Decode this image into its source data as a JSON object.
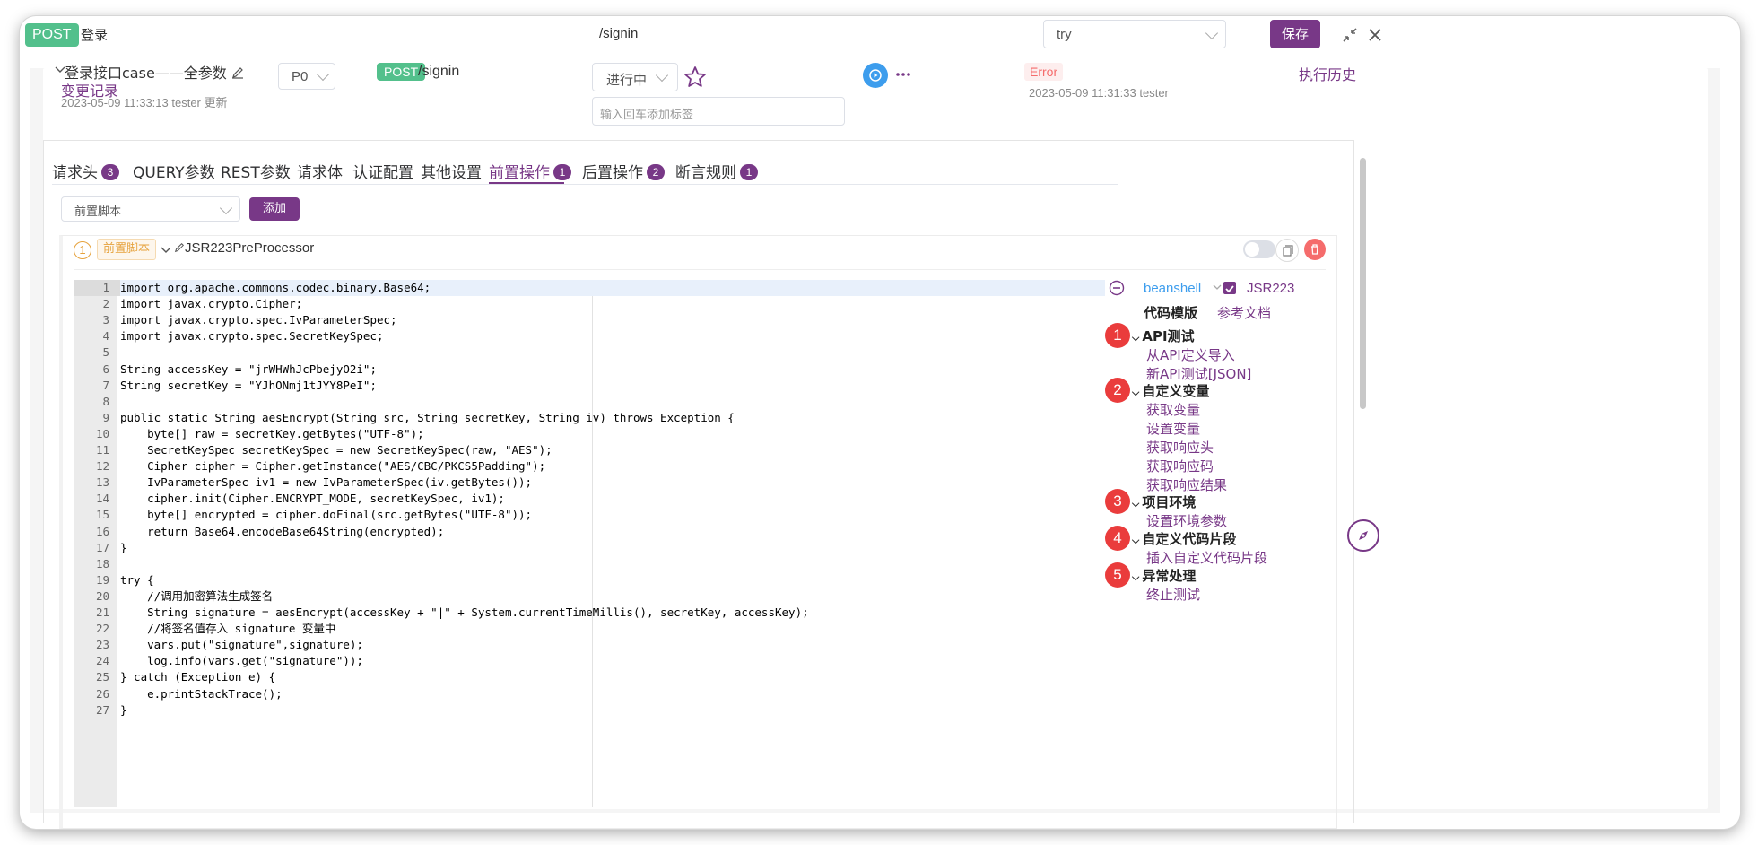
{
  "header": {
    "method": "POST",
    "name": "登录",
    "path": "/signin",
    "env_select": "try",
    "save_label": "保存"
  },
  "case": {
    "title": "登录接口case——全参数",
    "change_log": "变更记录",
    "updated": "2023-05-09 11:33:13 tester 更新",
    "priority": "P0",
    "method": "POST",
    "path": "/signin",
    "status": "进行中",
    "tag_placeholder": "输入回车添加标签",
    "result": "Error",
    "result_time": "2023-05-09 11:31:33 tester",
    "history": "执行历史"
  },
  "tabs": [
    {
      "label": "请求头",
      "count": "3"
    },
    {
      "label": "QUERY参数",
      "count": ""
    },
    {
      "label": "REST参数",
      "count": ""
    },
    {
      "label": "请求体",
      "count": ""
    },
    {
      "label": "认证配置",
      "count": ""
    },
    {
      "label": "其他设置",
      "count": ""
    },
    {
      "label": "前置操作",
      "count": "1"
    },
    {
      "label": "后置操作",
      "count": "2"
    },
    {
      "label": "断言规则",
      "count": "1"
    }
  ],
  "pre": {
    "type_select": "前置脚本",
    "add_label": "添加",
    "step_no": "1",
    "step_tag": "前置脚本",
    "step_name": "JSR223PreProcessor"
  },
  "code_lines": [
    "import org.apache.commons.codec.binary.Base64;",
    "import javax.crypto.Cipher;",
    "import javax.crypto.spec.IvParameterSpec;",
    "import javax.crypto.spec.SecretKeySpec;",
    "",
    "String accessKey = \"jrWHWhJcPbejyO2i\";",
    "String secretKey = \"YJhONmj1tJYY8PeI\";",
    "",
    "public static String aesEncrypt(String src, String secretKey, String iv) throws Exception {",
    "    byte[] raw = secretKey.getBytes(\"UTF-8\");",
    "    SecretKeySpec secretKeySpec = new SecretKeySpec(raw, \"AES\");",
    "    Cipher cipher = Cipher.getInstance(\"AES/CBC/PKCS5Padding\");",
    "    IvParameterSpec iv1 = new IvParameterSpec(iv.getBytes());",
    "    cipher.init(Cipher.ENCRYPT_MODE, secretKeySpec, iv1);",
    "    byte[] encrypted = cipher.doFinal(src.getBytes(\"UTF-8\"));",
    "    return Base64.encodeBase64String(encrypted);",
    "}",
    "",
    "try {",
    "    //调用加密算法生成签名",
    "    String signature = aesEncrypt(accessKey + \"|\" + System.currentTimeMillis(), secretKey, accessKey);",
    "    //将签名值存入 signature 变量中",
    "    vars.put(\"signature\",signature);",
    "    log.info(vars.get(\"signature\"));",
    "} catch (Exception e) {",
    "    e.printStackTrace();",
    "}"
  ],
  "side": {
    "language": "beanshell",
    "jsr_label": "JSR223",
    "template_label": "代码模版",
    "doc_link": "参考文档",
    "sections": [
      {
        "num": "1",
        "title": "API测试",
        "links": [
          "从API定义导入",
          "新API测试[JSON]"
        ]
      },
      {
        "num": "2",
        "title": "自定义变量",
        "links": [
          "获取变量",
          "设置变量",
          "获取响应头",
          "获取响应码",
          "获取响应结果"
        ]
      },
      {
        "num": "3",
        "title": "项目环境",
        "links": [
          "设置环境参数"
        ]
      },
      {
        "num": "4",
        "title": "自定义代码片段",
        "links": [
          "插入自定义代码片段"
        ]
      },
      {
        "num": "5",
        "title": "异常处理",
        "links": [
          "终止测试"
        ]
      }
    ]
  },
  "colors": {
    "brand": "#783887",
    "post": "#53c08c",
    "error_text": "#f56c6c",
    "badge_red": "#ea3c3c",
    "run_button": "#3d9ded"
  }
}
